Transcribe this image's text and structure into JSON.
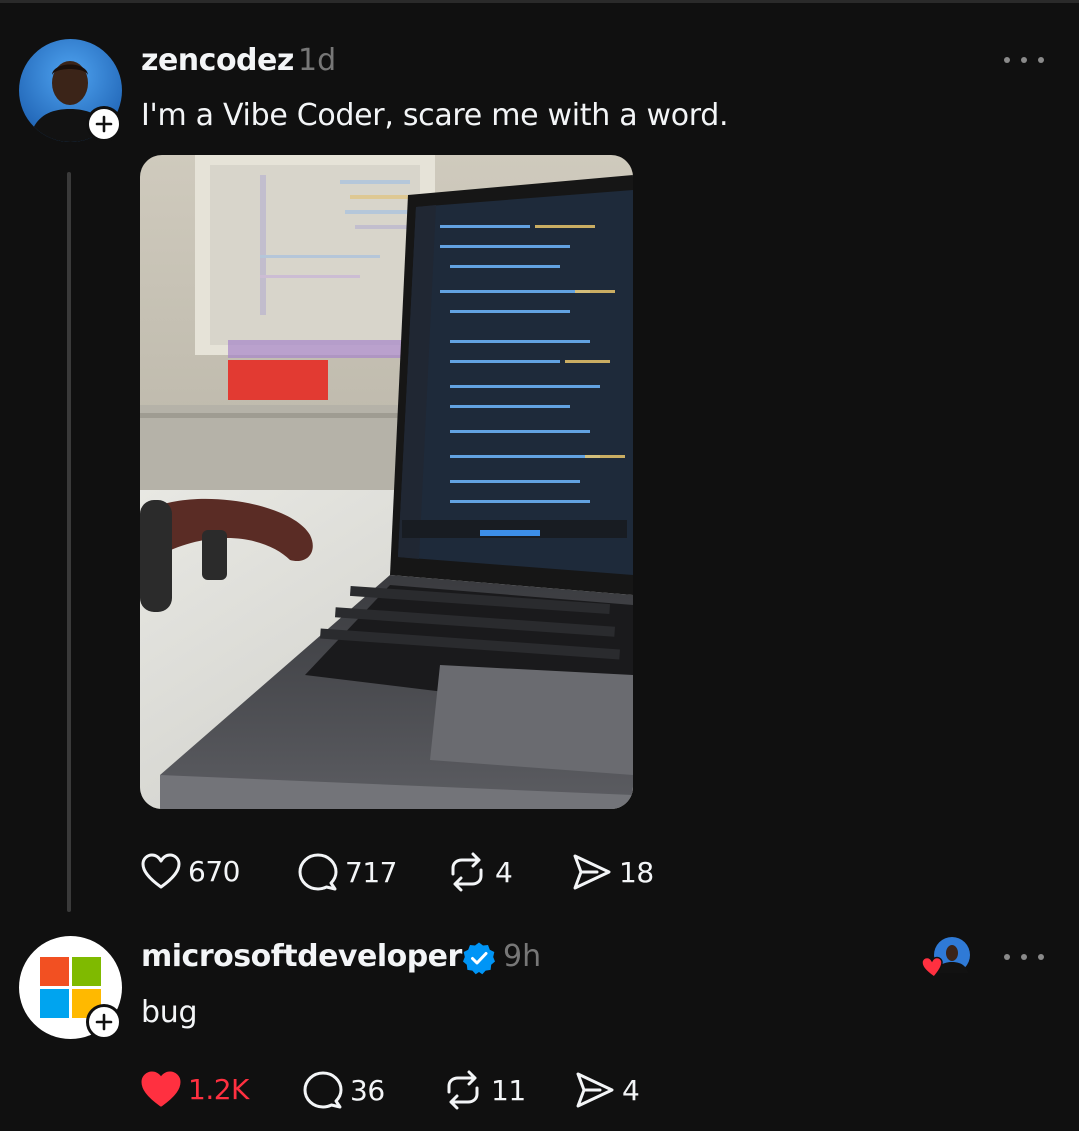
{
  "posts": [
    {
      "username": "zencodez",
      "time": "1d",
      "text": "I'm a Vibe Coder, scare me with a word.",
      "media_icon": "laptop-photo",
      "actions": {
        "likes": "670",
        "comments": "717",
        "reposts": "4",
        "shares": "18"
      }
    },
    {
      "username": "microsoftdeveloper",
      "verified": true,
      "time": "9h",
      "text": "bug",
      "liked": true,
      "actions": {
        "likes": "1.2K",
        "comments": "36",
        "reposts": "11",
        "shares": "4"
      }
    }
  ],
  "colors": {
    "background": "#101010",
    "like_active": "#ff3040",
    "verified": "#0095f6",
    "muted": "#777777"
  }
}
